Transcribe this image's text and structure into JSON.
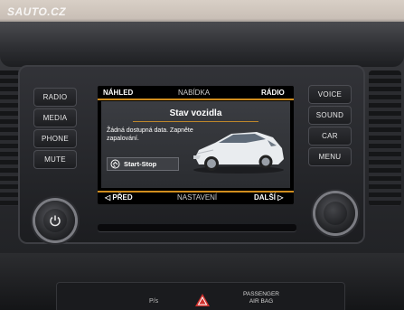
{
  "watermark": "SAUTO.CZ",
  "left_buttons": [
    "RADIO",
    "MEDIA",
    "PHONE",
    "MUTE"
  ],
  "right_buttons": [
    "VOICE",
    "SOUND",
    "CAR",
    "MENU"
  ],
  "screen": {
    "top_left": "NÁHLED",
    "top_center": "NABÍDKA",
    "top_right": "RÁDIO",
    "title": "Stav vozidla",
    "message": "Žádná dostupná data. Zapněte zapalování.",
    "start_stop_label": "Start-Stop",
    "bottom_left": "PŘED",
    "bottom_center": "NASTAVENÍ",
    "bottom_right": "DALŠÍ",
    "accent_color": "#f5a623"
  },
  "lower_panel": {
    "airbag_label_line1": "PASSENGER",
    "airbag_label_line2": "AIR BAG",
    "small_label": "P/s"
  }
}
